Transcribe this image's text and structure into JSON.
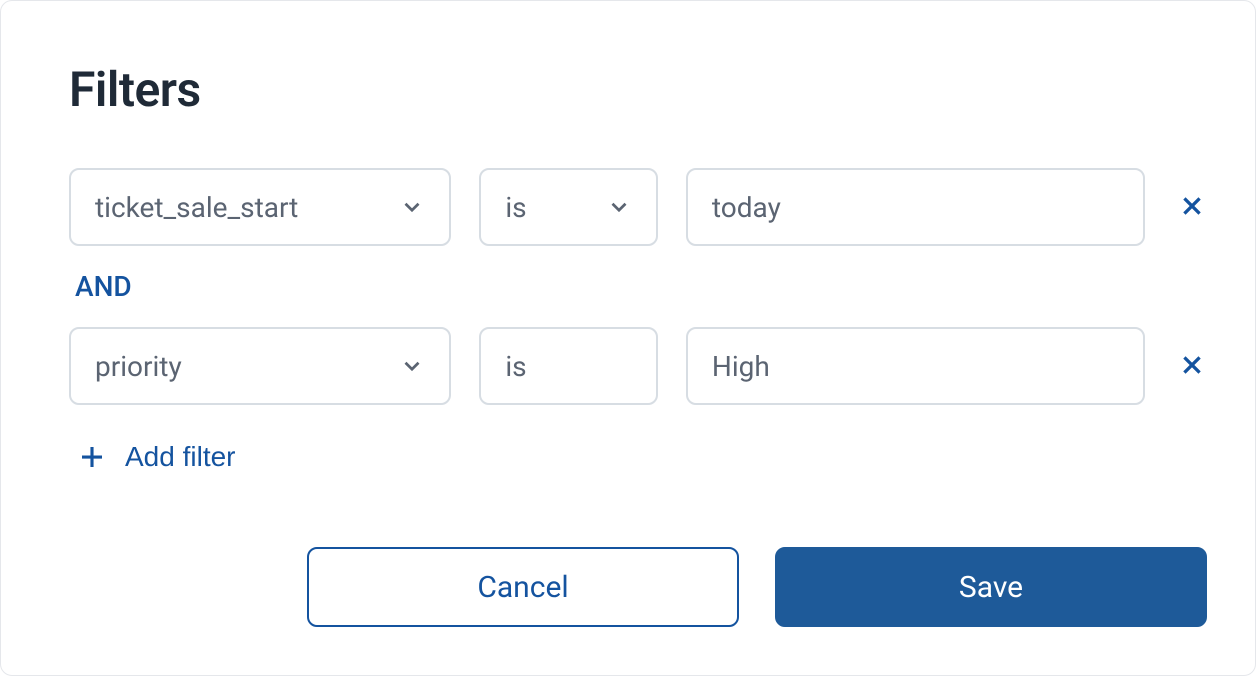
{
  "dialog": {
    "title": "Filters",
    "logical_operator": "AND",
    "add_filter_label": "Add filter",
    "cancel_label": "Cancel",
    "save_label": "Save"
  },
  "filters": [
    {
      "field": "ticket_sale_start",
      "operator": "is",
      "value": "today"
    },
    {
      "field": "priority",
      "operator": "is",
      "value": "High"
    }
  ],
  "colors": {
    "primary": "#1e5a99",
    "link": "#14539f",
    "border": "#d7dde3",
    "text_muted": "#5b6472",
    "text_heading": "#1f2a37"
  }
}
